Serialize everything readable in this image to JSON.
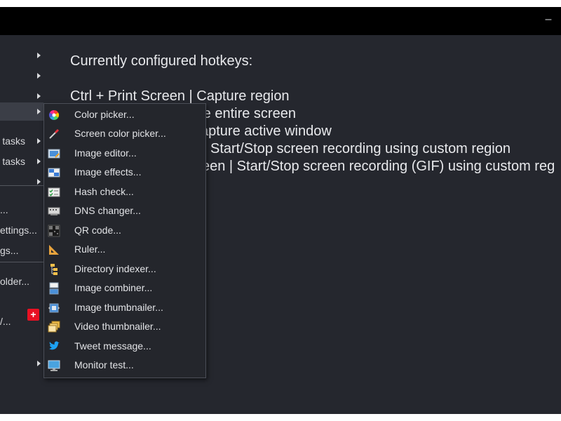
{
  "window": {
    "minimize_label": "–"
  },
  "left_menu": {
    "items": [
      {
        "label": "",
        "has_arrow": true
      },
      {
        "label": "",
        "has_arrow": true
      },
      {
        "label": "",
        "has_arrow": true
      },
      {
        "label": "",
        "has_arrow": true,
        "highlighted": true
      },
      {
        "label": "tasks",
        "has_arrow": true
      },
      {
        "label": "tasks",
        "has_arrow": true
      },
      {
        "label": "",
        "has_arrow": true
      },
      {
        "label": "...",
        "has_arrow": false
      },
      {
        "label": "ettings...",
        "has_arrow": false
      },
      {
        "label": "gs...",
        "has_arrow": false
      },
      {
        "label": "older...",
        "has_arrow": false
      },
      {
        "label": "",
        "has_arrow": false
      },
      {
        "label": "/...",
        "has_arrow": false
      },
      {
        "label": "",
        "has_arrow": false,
        "badge": "+"
      },
      {
        "label": "",
        "has_arrow": true
      }
    ]
  },
  "hotkeys": {
    "heading": "Currently configured hotkeys:",
    "lines": [
      "Ctrl + Print Screen  |  Capture region",
      "re entire screen",
      "apture active window",
      "Start/Stop screen recording using custom region",
      "een  |  Start/Stop screen recording (GIF) using custom reg"
    ]
  },
  "tools_submenu": {
    "items": [
      {
        "label": "Color picker...",
        "icon": "color-wheel-icon"
      },
      {
        "label": "Screen color picker...",
        "icon": "eyedropper-icon"
      },
      {
        "label": "Image editor...",
        "icon": "image-editor-icon"
      },
      {
        "label": "Image effects...",
        "icon": "image-effects-icon"
      },
      {
        "label": "Hash check...",
        "icon": "hash-check-icon"
      },
      {
        "label": "DNS changer...",
        "icon": "dns-icon"
      },
      {
        "label": "QR code...",
        "icon": "qr-code-icon"
      },
      {
        "label": "Ruler...",
        "icon": "ruler-icon"
      },
      {
        "label": "Directory indexer...",
        "icon": "directory-indexer-icon"
      },
      {
        "label": "Image combiner...",
        "icon": "image-combiner-icon"
      },
      {
        "label": "Image thumbnailer...",
        "icon": "image-thumbnailer-icon"
      },
      {
        "label": "Video thumbnailer...",
        "icon": "video-thumbnailer-icon"
      },
      {
        "label": "Tweet message...",
        "icon": "twitter-bird-icon"
      },
      {
        "label": "Monitor test...",
        "icon": "monitor-icon"
      }
    ]
  },
  "colors": {
    "background": "#25272e",
    "titlebar": "#000000",
    "badge": "#e81123"
  }
}
